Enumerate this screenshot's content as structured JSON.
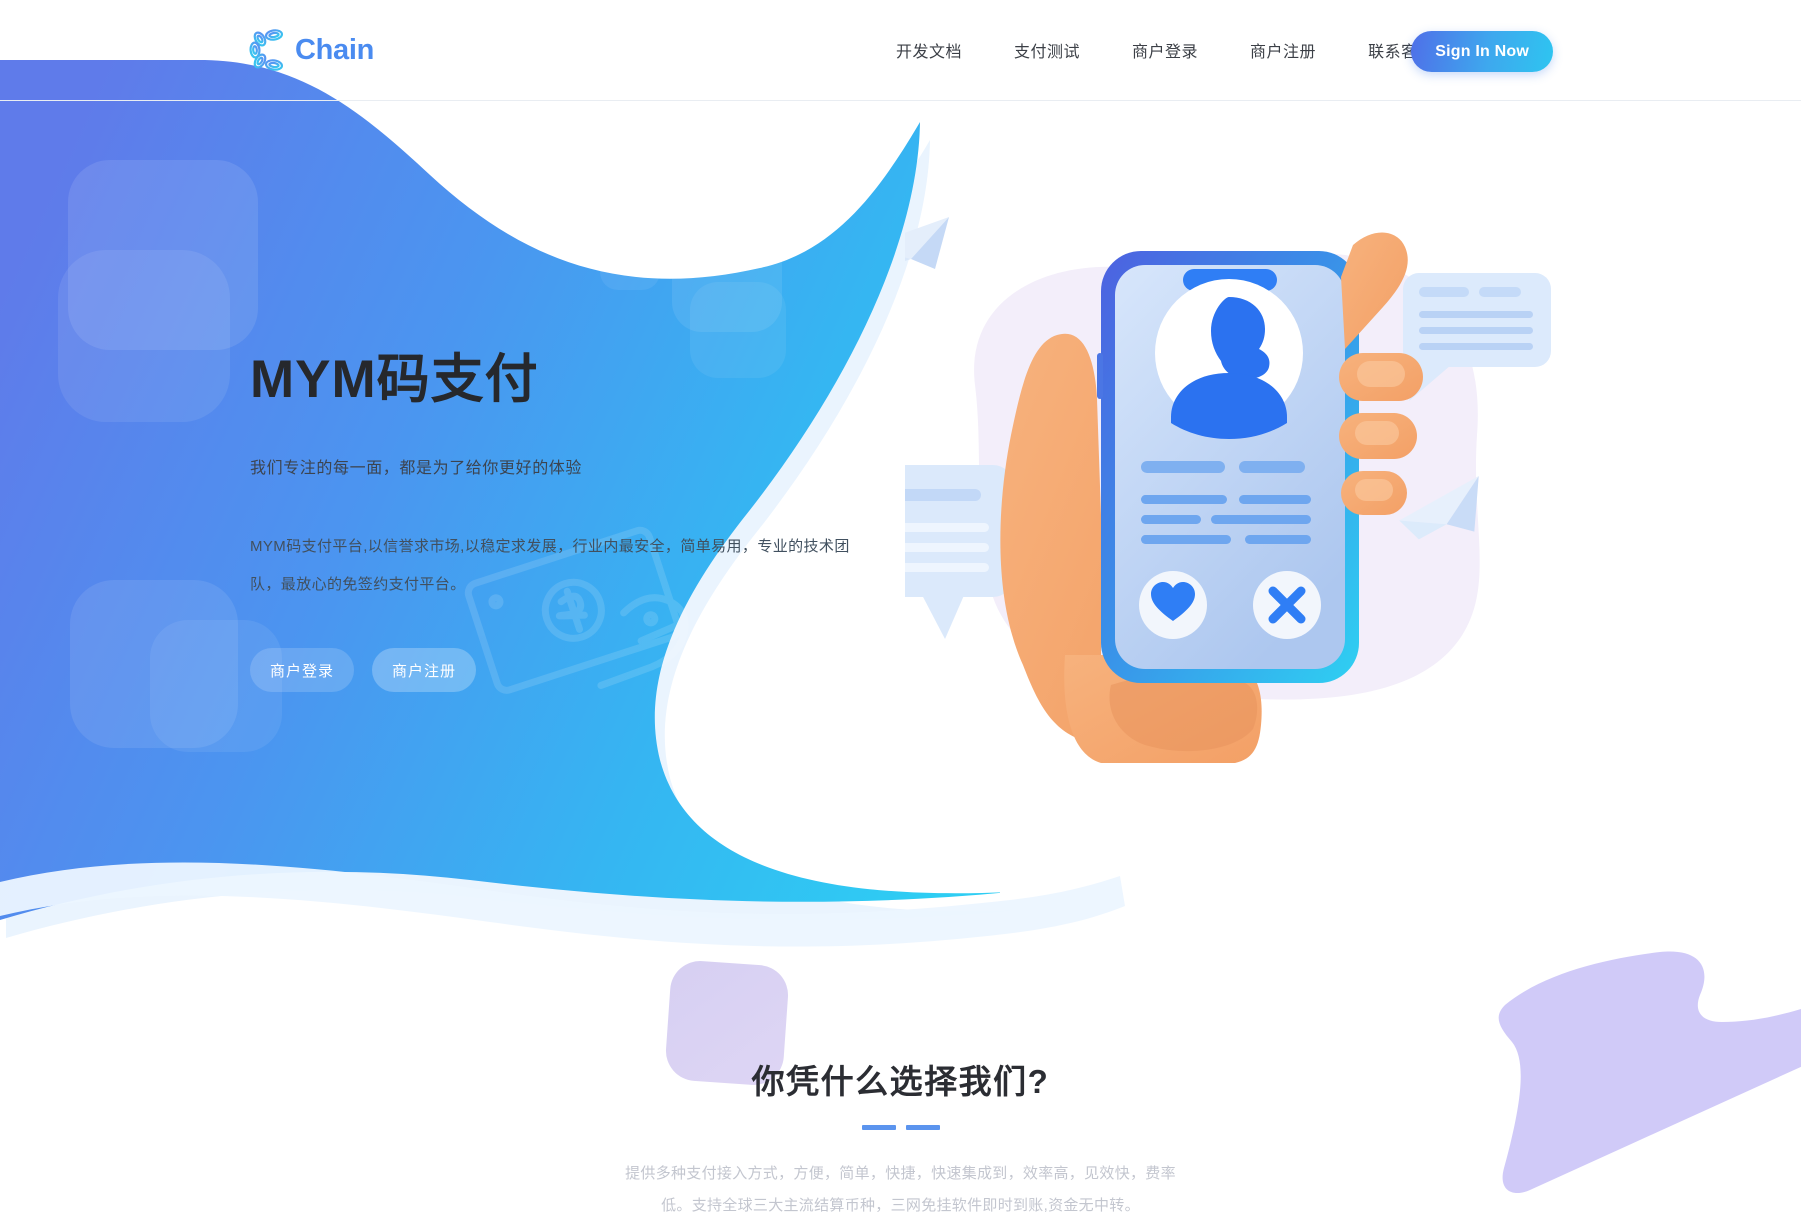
{
  "header": {
    "brand": "Chain",
    "brand_icon": "chain-link-c-logo",
    "nav": [
      {
        "label": "开发文档"
      },
      {
        "label": "支付测试"
      },
      {
        "label": "商户登录"
      },
      {
        "label": "商户注册"
      },
      {
        "label": "联系客服"
      }
    ],
    "signin_label": "Sign In Now"
  },
  "hero": {
    "title": "MYM码支付",
    "subtitle": "我们专注的每一面，都是为了给你更好的体验",
    "description": "MYM码支付平台,以信誉求市场,以稳定求发展，行业内最安全，简单易用，专业的技术团队，最放心的免签约支付平台。",
    "buttons": [
      {
        "label": "商户登录"
      },
      {
        "label": "商户注册"
      }
    ],
    "watermark_icon": "hand-holding-banknote-icon"
  },
  "illustration": {
    "name": "hand-holding-phone-illustration",
    "phone_screen": {
      "avatar_icon": "user-avatar-icon",
      "like_icon": "heart-icon",
      "dismiss_icon": "close-x-icon"
    },
    "decorations": [
      "paper-plane-icon",
      "chat-bubble-icon",
      "chat-bubble-icon",
      "paper-plane-icon"
    ]
  },
  "section2": {
    "title": "你凭什么选择我们?",
    "description": "提供多种支付接入方式，方便，简单，快捷，快速集成到，效率高，见效快，费率低。支持全球三大主流结算币种，三网免挂软件即时到账,资金无中转。"
  },
  "colors": {
    "brand_blue": "#4a8bf0",
    "gradient_start": "#4f6fe8",
    "gradient_end": "#2ec5f0",
    "divider": "#5b94ee",
    "accent_orange": "#f5a871",
    "accent_purple": "#ccc5f7"
  }
}
